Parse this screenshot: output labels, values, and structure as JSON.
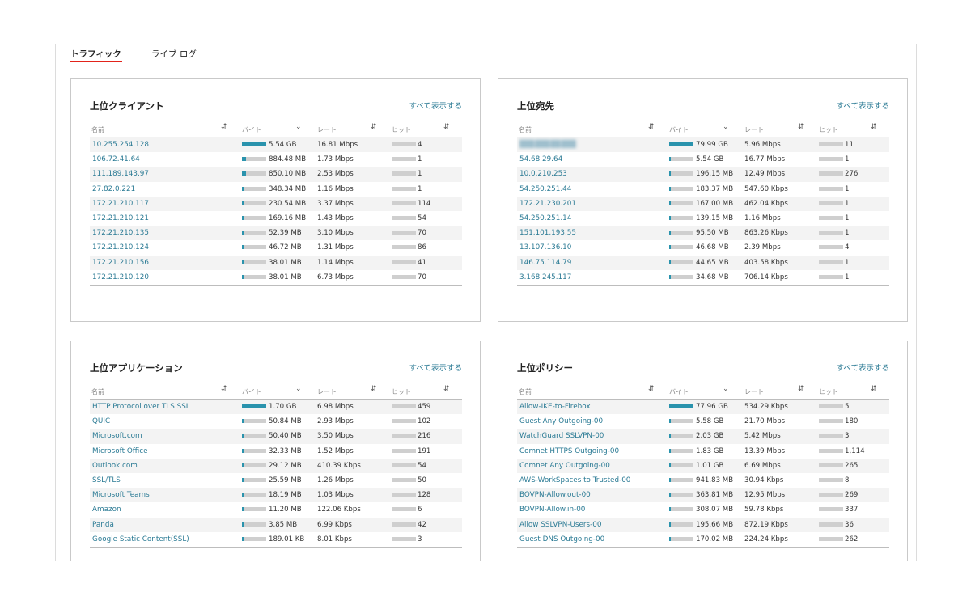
{
  "tabs": [
    "トラフィック",
    "ライブ ログ"
  ],
  "show_all_label": "すべて表示する",
  "columns": [
    "名前",
    "バイト",
    "レート",
    "ヒット"
  ],
  "colors": {
    "accent": "#2a93ad",
    "link": "#2a7a94",
    "tab_underline": "#e2231a"
  },
  "panels": [
    {
      "title": "上位クライアント",
      "rows": [
        {
          "name": "10.255.254.128",
          "bytes": "5.54 GB",
          "rate": "16.81 Mbps",
          "hits": "4",
          "share": 1.0
        },
        {
          "name": "106.72.41.64",
          "bytes": "884.48 MB",
          "rate": "1.73 Mbps",
          "hits": "1",
          "share": 0.16
        },
        {
          "name": "111.189.143.97",
          "bytes": "850.10 MB",
          "rate": "2.53 Mbps",
          "hits": "1",
          "share": 0.15
        },
        {
          "name": "27.82.0.221",
          "bytes": "348.34 MB",
          "rate": "1.16 Mbps",
          "hits": "1",
          "share": 0.06
        },
        {
          "name": "172.21.210.117",
          "bytes": "230.54 MB",
          "rate": "3.37 Mbps",
          "hits": "114",
          "share": 0.04
        },
        {
          "name": "172.21.210.121",
          "bytes": "169.16 MB",
          "rate": "1.43 Mbps",
          "hits": "54",
          "share": 0.03
        },
        {
          "name": "172.21.210.135",
          "bytes": "52.39 MB",
          "rate": "3.10 Mbps",
          "hits": "70",
          "share": 0.01
        },
        {
          "name": "172.21.210.124",
          "bytes": "46.72 MB",
          "rate": "1.31 Mbps",
          "hits": "86",
          "share": 0.01
        },
        {
          "name": "172.21.210.156",
          "bytes": "38.01 MB",
          "rate": "1.14 Mbps",
          "hits": "41",
          "share": 0.01
        },
        {
          "name": "172.21.210.120",
          "bytes": "38.01 MB",
          "rate": "6.73 Mbps",
          "hits": "70",
          "share": 0.01
        }
      ]
    },
    {
      "title": "上位宛先",
      "rows": [
        {
          "name": "",
          "bytes": "79.99 GB",
          "rate": "5.96 Mbps",
          "hits": "11",
          "share": 1.0,
          "blurred": true
        },
        {
          "name": "54.68.29.64",
          "bytes": "5.54 GB",
          "rate": "16.77 Mbps",
          "hits": "1",
          "share": 0.07
        },
        {
          "name": "10.0.210.253",
          "bytes": "196.15 MB",
          "rate": "12.49 Mbps",
          "hits": "276",
          "share": 0.01
        },
        {
          "name": "54.250.251.44",
          "bytes": "183.37 MB",
          "rate": "547.60 Kbps",
          "hits": "1",
          "share": 0.01
        },
        {
          "name": "172.21.230.201",
          "bytes": "167.00 MB",
          "rate": "462.04 Kbps",
          "hits": "1",
          "share": 0.01
        },
        {
          "name": "54.250.251.14",
          "bytes": "139.15 MB",
          "rate": "1.16 Mbps",
          "hits": "1",
          "share": 0.01
        },
        {
          "name": "151.101.193.55",
          "bytes": "95.50 MB",
          "rate": "863.26 Kbps",
          "hits": "1",
          "share": 0.01
        },
        {
          "name": "13.107.136.10",
          "bytes": "46.68 MB",
          "rate": "2.39 Mbps",
          "hits": "4",
          "share": 0.01
        },
        {
          "name": "146.75.114.79",
          "bytes": "44.65 MB",
          "rate": "403.58 Kbps",
          "hits": "1",
          "share": 0.01
        },
        {
          "name": "3.168.245.117",
          "bytes": "34.68 MB",
          "rate": "706.14 Kbps",
          "hits": "1",
          "share": 0.01
        }
      ]
    },
    {
      "title": "上位アプリケーション",
      "rows": [
        {
          "name": "HTTP Protocol over TLS SSL",
          "bytes": "1.70 GB",
          "rate": "6.98 Mbps",
          "hits": "459",
          "share": 1.0
        },
        {
          "name": "QUIC",
          "bytes": "50.84 MB",
          "rate": "2.93 Mbps",
          "hits": "102",
          "share": 0.03
        },
        {
          "name": "Microsoft.com",
          "bytes": "50.40 MB",
          "rate": "3.50 Mbps",
          "hits": "216",
          "share": 0.03
        },
        {
          "name": "Microsoft Office",
          "bytes": "32.33 MB",
          "rate": "1.52 Mbps",
          "hits": "191",
          "share": 0.02
        },
        {
          "name": "Outlook.com",
          "bytes": "29.12 MB",
          "rate": "410.39 Kbps",
          "hits": "54",
          "share": 0.02
        },
        {
          "name": "SSL/TLS",
          "bytes": "25.59 MB",
          "rate": "1.26 Mbps",
          "hits": "50",
          "share": 0.02
        },
        {
          "name": "Microsoft Teams",
          "bytes": "18.19 MB",
          "rate": "1.03 Mbps",
          "hits": "128",
          "share": 0.01
        },
        {
          "name": "Amazon",
          "bytes": "11.20 MB",
          "rate": "122.06 Kbps",
          "hits": "6",
          "share": 0.01
        },
        {
          "name": "Panda",
          "bytes": "3.85 MB",
          "rate": "6.99 Kbps",
          "hits": "42",
          "share": 0.01
        },
        {
          "name": "Google Static Content(SSL)",
          "bytes": "189.01 KB",
          "rate": "8.01 Kbps",
          "hits": "3",
          "share": 0.01
        }
      ]
    },
    {
      "title": "上位ポリシー",
      "rows": [
        {
          "name": "Allow-IKE-to-Firebox",
          "bytes": "77.96 GB",
          "rate": "534.29 Kbps",
          "hits": "5",
          "share": 1.0
        },
        {
          "name": "Guest Any Outgoing-00",
          "bytes": "5.58 GB",
          "rate": "21.70 Mbps",
          "hits": "180",
          "share": 0.07
        },
        {
          "name": "WatchGuard SSLVPN-00",
          "bytes": "2.03 GB",
          "rate": "5.42 Mbps",
          "hits": "3",
          "share": 0.03
        },
        {
          "name": "Comnet HTTPS Outgoing-00",
          "bytes": "1.83 GB",
          "rate": "13.39 Mbps",
          "hits": "1,114",
          "share": 0.02
        },
        {
          "name": "Comnet Any Outgoing-00",
          "bytes": "1.01 GB",
          "rate": "6.69 Mbps",
          "hits": "265",
          "share": 0.01
        },
        {
          "name": "AWS-WorkSpaces to Trusted-00",
          "bytes": "941.83 MB",
          "rate": "30.94 Kbps",
          "hits": "8",
          "share": 0.01
        },
        {
          "name": "BOVPN-Allow.out-00",
          "bytes": "363.81 MB",
          "rate": "12.95 Mbps",
          "hits": "269",
          "share": 0.01
        },
        {
          "name": "BOVPN-Allow.in-00",
          "bytes": "308.07 MB",
          "rate": "59.78 Kbps",
          "hits": "337",
          "share": 0.01
        },
        {
          "name": "Allow SSLVPN-Users-00",
          "bytes": "195.66 MB",
          "rate": "872.19 Kbps",
          "hits": "36",
          "share": 0.01
        },
        {
          "name": "Guest DNS Outgoing-00",
          "bytes": "170.02 MB",
          "rate": "224.24 Kbps",
          "hits": "262",
          "share": 0.01
        }
      ]
    }
  ]
}
